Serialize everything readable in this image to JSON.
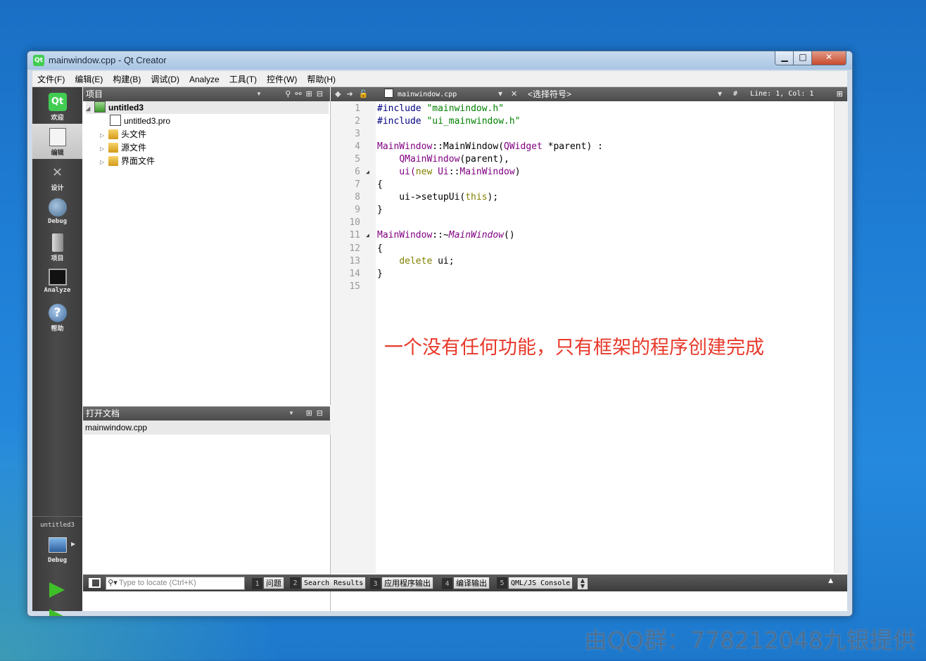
{
  "window": {
    "title": "mainwindow.cpp - Qt Creator",
    "app_icon": "Qt"
  },
  "window_controls": {
    "minimize": "▁",
    "maximize": "□",
    "close": "✕"
  },
  "menu": [
    "文件(F)",
    "编辑(E)",
    "构建(B)",
    "调试(D)",
    "Analyze",
    "工具(T)",
    "控件(W)",
    "帮助(H)"
  ],
  "modes": [
    {
      "label": "欢迎",
      "icon": "qt-logo-icon"
    },
    {
      "label": "编辑",
      "icon": "edit-document-icon",
      "active": true
    },
    {
      "label": "设计",
      "icon": "design-tools-icon"
    },
    {
      "label": "Debug",
      "icon": "debug-bug-icon"
    },
    {
      "label": "项目",
      "icon": "project-icon"
    },
    {
      "label": "Analyze",
      "icon": "analyze-monitor-icon"
    },
    {
      "label": "帮助",
      "icon": "help-icon"
    }
  ],
  "kit": {
    "project": "untitled3",
    "config": "Debug"
  },
  "project_panel": {
    "title": "项目",
    "tree": [
      {
        "label": "untitled3",
        "type": "project"
      },
      {
        "label": "untitled3.pro",
        "type": "pro-file"
      },
      {
        "label": "头文件",
        "type": "folder"
      },
      {
        "label": "源文件",
        "type": "folder"
      },
      {
        "label": "界面文件",
        "type": "folder"
      }
    ]
  },
  "open_docs_panel": {
    "title": "打开文档",
    "items": [
      "mainwindow.cpp"
    ]
  },
  "editor": {
    "file": "mainwindow.cpp",
    "symbol": "<选择符号>",
    "hash": "#",
    "position": "Line: 1, Col: 1",
    "line_numbers": [
      "1",
      "2",
      "3",
      "4",
      "5",
      "6",
      "7",
      "8",
      "9",
      "10",
      "11",
      "12",
      "13",
      "14",
      "15"
    ],
    "code": {
      "l1_pp": "#include",
      "l1_str": " \"mainwindow.h\"",
      "l2_pp": "#include",
      "l2_str": " \"ui_mainwindow.h\"",
      "l4_a": "MainWindow",
      "l4_b": "::MainWindow(",
      "l4_c": "QWidget",
      "l4_d": " *parent) :",
      "l5_a": "    ",
      "l5_b": "QMainWindow",
      "l5_c": "(parent),",
      "l6_a": "    ui(",
      "l6_b": "new",
      "l6_c": " ",
      "l6_d": "Ui",
      "l6_e": "::",
      "l6_f": "MainWindow",
      "l6_g": ")",
      "l7": "{",
      "l8_a": "    ui->setupUi(",
      "l8_b": "this",
      "l8_c": ");",
      "l9": "}",
      "l11_a": "MainWindow",
      "l11_b": "::~",
      "l11_c": "MainWindow",
      "l11_d": "()",
      "l12": "{",
      "l13_a": "    ",
      "l13_b": "delete",
      "l13_c": " ui;",
      "l14": "}"
    }
  },
  "annotation": "一个没有任何功能，只有框架的程序创建完成",
  "statusbar": {
    "locator_placeholder": "Type to locate (Ctrl+K)",
    "panes": [
      {
        "num": "1",
        "label": "问题"
      },
      {
        "num": "2",
        "label": "Search Results"
      },
      {
        "num": "3",
        "label": "应用程序输出"
      },
      {
        "num": "4",
        "label": "编译输出"
      },
      {
        "num": "5",
        "label": "QML/JS Console"
      }
    ]
  },
  "watermark": "由QQ群：778212048九银提供",
  "colors": {
    "preprocessor": "#000080",
    "string": "#008000",
    "type": "#800080",
    "keyword": "#808000",
    "annotation": "#e8392b"
  }
}
